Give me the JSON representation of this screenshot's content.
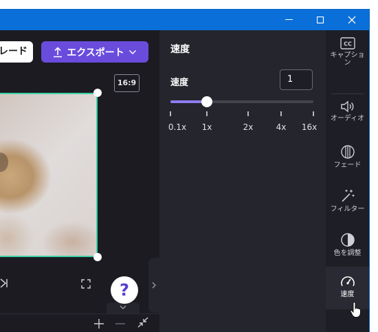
{
  "editor": {
    "download_partial_label": "レード",
    "export_label": "エクスポート",
    "aspect_ratio": "16:9",
    "help_label": "?"
  },
  "speed_panel": {
    "title": "速度",
    "speed_label": "速度",
    "speed_value": "1",
    "slider_value": "1x",
    "tick_labels": [
      "0.1x",
      "1x",
      "2x",
      "4x",
      "16x"
    ]
  },
  "sidebar": {
    "items": [
      {
        "label": "キャプション",
        "icon": "captions-icon"
      },
      {
        "label": "オーディオ",
        "icon": "audio-icon"
      },
      {
        "label": "フェード",
        "icon": "fade-icon"
      },
      {
        "label": "フィルター",
        "icon": "filter-wand-icon"
      },
      {
        "label": "色を調整",
        "icon": "color-adjust-icon"
      },
      {
        "label": "速度",
        "icon": "speedometer-icon",
        "active": true
      }
    ]
  },
  "colors": {
    "title_bar": "#0a6fd8",
    "export_button": "#6a4cdd",
    "slider_fill": "#8e7df0",
    "selection_border": "#3ed0a6"
  }
}
